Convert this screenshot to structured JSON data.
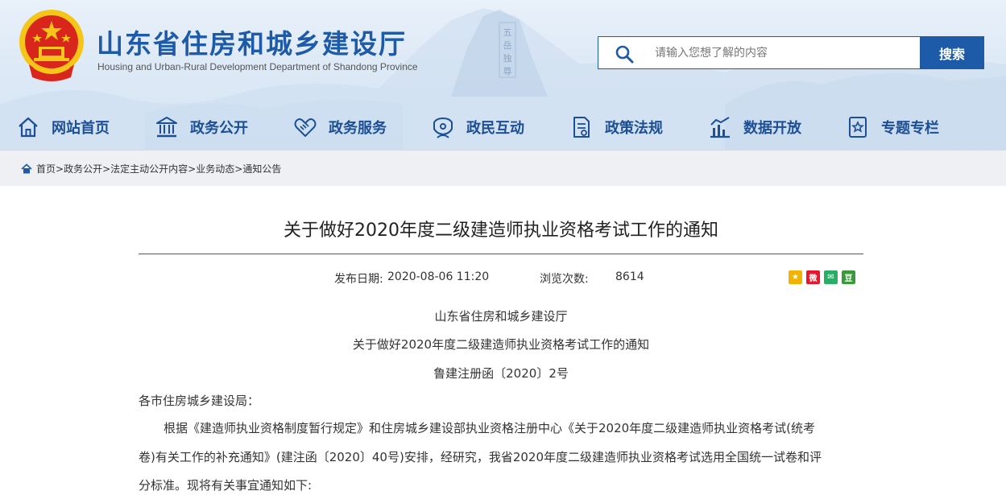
{
  "header": {
    "site_title": "山东省住房和城乡建设厅",
    "site_subtitle": "Housing and Urban-Rural Development Department of Shandong Province",
    "search_placeholder": "请输入您想了解的内容",
    "search_button": "搜索",
    "emblem_icon": "national-emblem-icon",
    "seal_text": "五岳独尊"
  },
  "nav": [
    {
      "label": "网站首页",
      "icon": "home-icon"
    },
    {
      "label": "政务公开",
      "icon": "building-icon"
    },
    {
      "label": "政务服务",
      "icon": "handshake-icon"
    },
    {
      "label": "政民互动",
      "icon": "chat-icon"
    },
    {
      "label": "政策法规",
      "icon": "document-icon"
    },
    {
      "label": "数据开放",
      "icon": "chart-icon"
    },
    {
      "label": "专题专栏",
      "icon": "star-doc-icon"
    }
  ],
  "breadcrumb": {
    "items": [
      "首页",
      "政务公开",
      "法定主动公开内容",
      "业务动态",
      "通知公告"
    ],
    "separator": ">"
  },
  "article": {
    "title": "关于做好2020年度二级建造师执业资格考试工作的通知",
    "publish_label": "发布日期:",
    "publish_date": "2020-08-06 11:20",
    "views_label": "浏览次数:",
    "views": "8614",
    "share_icons": [
      "qzone-icon",
      "weibo-icon",
      "wechat-icon",
      "douban-icon"
    ],
    "issuer": "山东省住房和城乡建设厅",
    "doc_title": "关于做好2020年度二级建造师执业资格考试工作的通知",
    "doc_number": "鲁建注册函〔2020〕2号",
    "salutation": "各市住房城乡建设局：",
    "body_line1": "根据《建造师执业资格制度暂行规定》和住房城乡建设部执业资格注册中心《关于2020年度二级建造师执业资格考试(统考",
    "body_line2": "卷)有关工作的补充通知》(建注函〔2020〕40号)安排，经研究，我省2020年度二级建造师执业资格考试选用全国统一试卷和评",
    "body_line3": "分标准。现将有关事宜通知如下:"
  },
  "colors": {
    "brand_blue": "#1d5ba8",
    "nav_text": "#1d4f94",
    "emblem_red": "#d9261c",
    "emblem_gold": "#f5c518"
  }
}
